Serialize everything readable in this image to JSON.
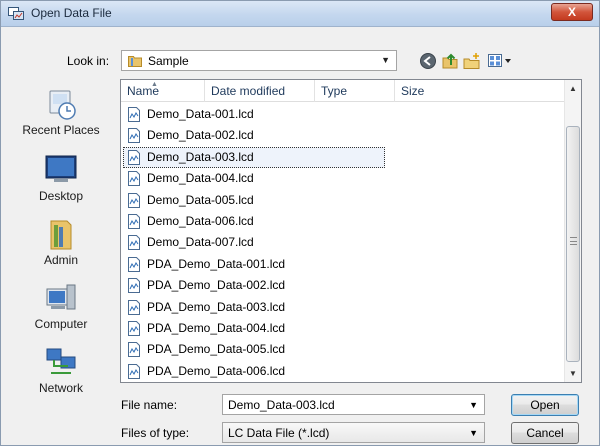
{
  "window": {
    "title": "Open Data File",
    "close_label": "X"
  },
  "lookin": {
    "label": "Look in:",
    "value": "Sample",
    "toolbar_icons": [
      "back-icon",
      "up-folder-icon",
      "new-folder-icon",
      "views-menu-icon"
    ]
  },
  "places": [
    {
      "label": "Recent Places",
      "icon": "recent-places-icon"
    },
    {
      "label": "Desktop",
      "icon": "desktop-icon"
    },
    {
      "label": "Admin",
      "icon": "user-folder-icon"
    },
    {
      "label": "Computer",
      "icon": "computer-icon"
    },
    {
      "label": "Network",
      "icon": "network-icon"
    }
  ],
  "columns": [
    "Name",
    "Date modified",
    "Type",
    "Size"
  ],
  "files": [
    "Demo_Data-001.lcd",
    "Demo_Data-002.lcd",
    "Demo_Data-003.lcd",
    "Demo_Data-004.lcd",
    "Demo_Data-005.lcd",
    "Demo_Data-006.lcd",
    "Demo_Data-007.lcd",
    "PDA_Demo_Data-001.lcd",
    "PDA_Demo_Data-002.lcd",
    "PDA_Demo_Data-003.lcd",
    "PDA_Demo_Data-004.lcd",
    "PDA_Demo_Data-005.lcd",
    "PDA_Demo_Data-006.lcd"
  ],
  "selected_index": 2,
  "filename": {
    "label": "File name:",
    "value": "Demo_Data-003.lcd"
  },
  "filetype": {
    "label": "Files of type:",
    "value": "LC Data File (*.lcd)"
  },
  "buttons": {
    "open": "Open",
    "cancel": "Cancel"
  },
  "colors": {
    "title_bar": "#c4d7ee",
    "close_button": "#d2553b",
    "selection": "#eef3fb",
    "column_text": "#1e395b"
  }
}
